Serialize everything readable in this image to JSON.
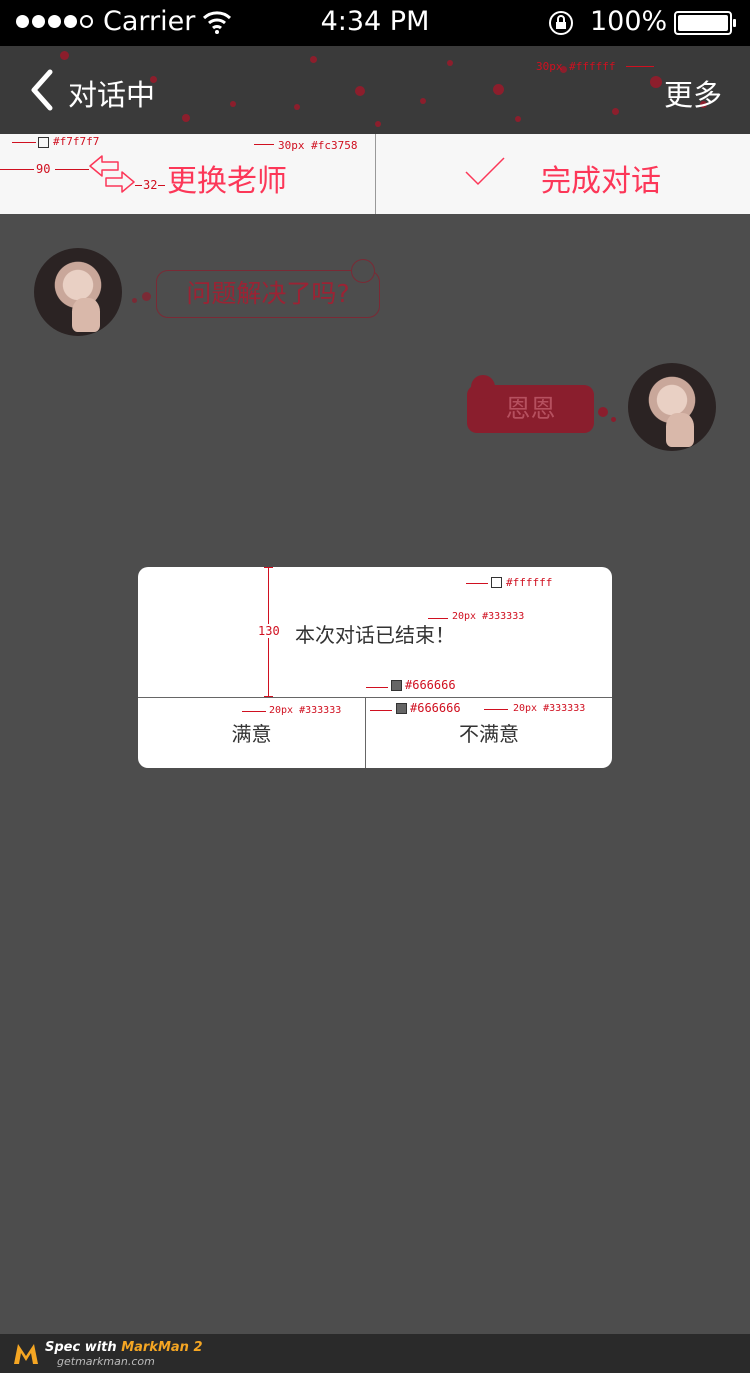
{
  "status_bar": {
    "carrier": "Carrier",
    "time": "4:34 PM",
    "battery": "100%"
  },
  "nav": {
    "title": "对话中",
    "more": "更多"
  },
  "actions": {
    "change_teacher": "更换老师",
    "finish": "完成对话"
  },
  "chat": {
    "incoming": "问题解决了吗?",
    "outgoing": "恩恩"
  },
  "dialog": {
    "message": "本次对话已结束！",
    "satisfied": "满意",
    "unsatisfied": "不满意"
  },
  "annotations": {
    "nav_more_spec": "30px  #ffffff",
    "action_bg": "#f7f7f7",
    "action_font": "30px  #fc3758",
    "dim_90": "90",
    "dim_32": "32",
    "dim_130": "130",
    "dialog_bg": "#ffffff",
    "dialog_msg": "20px  #333333",
    "line_color_1": "#666666",
    "line_color_2": "#666666",
    "btn_left": "20px  #333333",
    "btn_right": "20px  #333333"
  },
  "footer": {
    "brand_prefix": "Spec with ",
    "brand": "MarkMan 2",
    "site": "getmarkman.com"
  },
  "colors": {
    "accent": "#fc3758",
    "background": "#4d4d4d",
    "action_bg": "#f7f7f7",
    "text": "#333333",
    "divider": "#666666"
  }
}
